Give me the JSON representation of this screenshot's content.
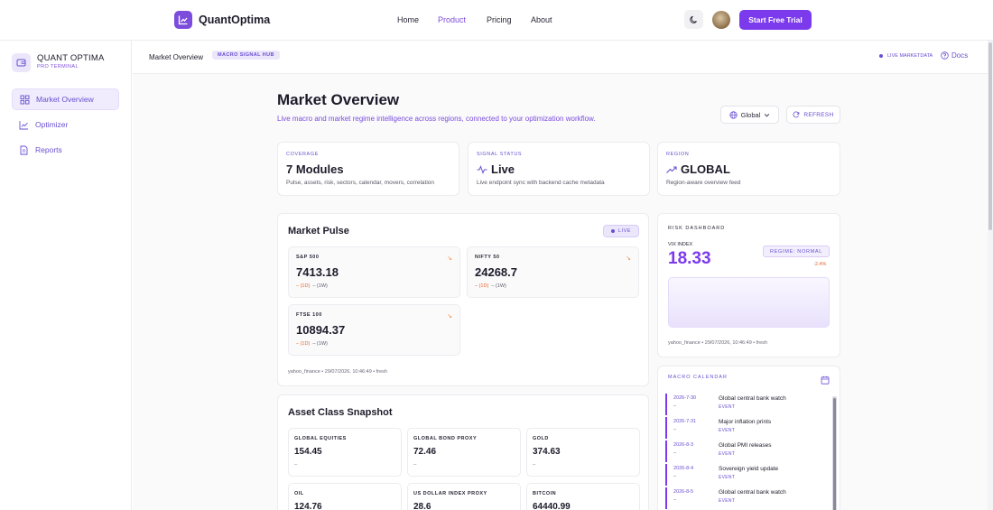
{
  "topnav": {
    "brand": "QuantOptima",
    "links": [
      "Home",
      "Product",
      "Pricing",
      "About"
    ],
    "active_link": "Product",
    "cta_label": "Start Free Trial",
    "accent": "#7c3aed"
  },
  "sidebar": {
    "title": "QUANT OPTIMA",
    "subtitle": "PRO TERMINAL",
    "items": [
      {
        "label": "Market Overview",
        "icon": "grid-icon",
        "active": true
      },
      {
        "label": "Optimizer",
        "icon": "trend-chart-icon",
        "active": false
      },
      {
        "label": "Reports",
        "icon": "document-icon",
        "active": false
      }
    ]
  },
  "subheader": {
    "crumb": "Market Overview",
    "badge": "MACRO SIGNAL HUB",
    "status": "LIVE MARKETDATA",
    "docs": "Docs"
  },
  "header": {
    "title": "Market Overview",
    "subtitle": "Live macro and market regime intelligence across regions, connected to your optimization workflow.",
    "region_select": "Global",
    "refresh_label": "REFRESH"
  },
  "stats": [
    {
      "kicker": "COVERAGE",
      "value": "7 Modules",
      "desc": "Pulse, assets, risk, sectors, calendar, movers, correlation"
    },
    {
      "kicker": "SIGNAL STATUS",
      "value": "Live",
      "desc": "Live endpoint sync with backend cache metadata"
    },
    {
      "kicker": "REGION",
      "value": "GLOBAL",
      "desc": "Region-aware overview feed"
    }
  ],
  "pulse": {
    "title": "Market Pulse",
    "badge": "LIVE",
    "tiles": [
      {
        "label": "S&P 500",
        "value": "7413.18",
        "chg_1d": "– (1D)",
        "chg_1w": "– (1W)"
      },
      {
        "label": "NIFTY 50",
        "value": "24268.7",
        "chg_1d": "– (1D)",
        "chg_1w": "– (1W)"
      },
      {
        "label": "FTSE 100",
        "value": "10894.37",
        "chg_1d": "– (1D)",
        "chg_1w": "– (1W)"
      }
    ],
    "footer": "yahoo_finance • 29/07/2026, 10:46:49 • fresh"
  },
  "assets": {
    "title": "Asset Class Snapshot",
    "items": [
      {
        "label": "GLOBAL EQUITIES",
        "value": "154.45",
        "chg": "–"
      },
      {
        "label": "GLOBAL BOND PROXY",
        "value": "72.46",
        "chg": "–"
      },
      {
        "label": "GOLD",
        "value": "374.63",
        "chg": "–"
      },
      {
        "label": "OIL",
        "value": "124.76",
        "chg": ""
      },
      {
        "label": "US DOLLAR INDEX PROXY",
        "value": "28.6",
        "chg": ""
      },
      {
        "label": "BITCOIN",
        "value": "64440.99",
        "chg": ""
      }
    ]
  },
  "risk": {
    "kicker": "RISK DASHBOARD",
    "vix_label": "VIX INDEX",
    "vix_value": "18.33",
    "regime": "REGIME: NORMAL",
    "vix_change": "-2.4%",
    "footer": "yahoo_finance • 29/07/2026, 10:46:49 • fresh"
  },
  "calendar": {
    "kicker": "MACRO CALENDAR",
    "events": [
      {
        "date": "2026-7-30",
        "dash": "–",
        "title": "Global central bank watch",
        "type": "EVENT"
      },
      {
        "date": "2026-7-31",
        "dash": "–",
        "title": "Major inflation prints",
        "type": "EVENT"
      },
      {
        "date": "2026-8-3",
        "dash": "–",
        "title": "Global PMI releases",
        "type": "EVENT"
      },
      {
        "date": "2026-8-4",
        "dash": "–",
        "title": "Sovereign yield update",
        "type": "EVENT"
      },
      {
        "date": "2026-8-5",
        "dash": "–",
        "title": "Global central bank watch",
        "type": "EVENT"
      }
    ]
  }
}
